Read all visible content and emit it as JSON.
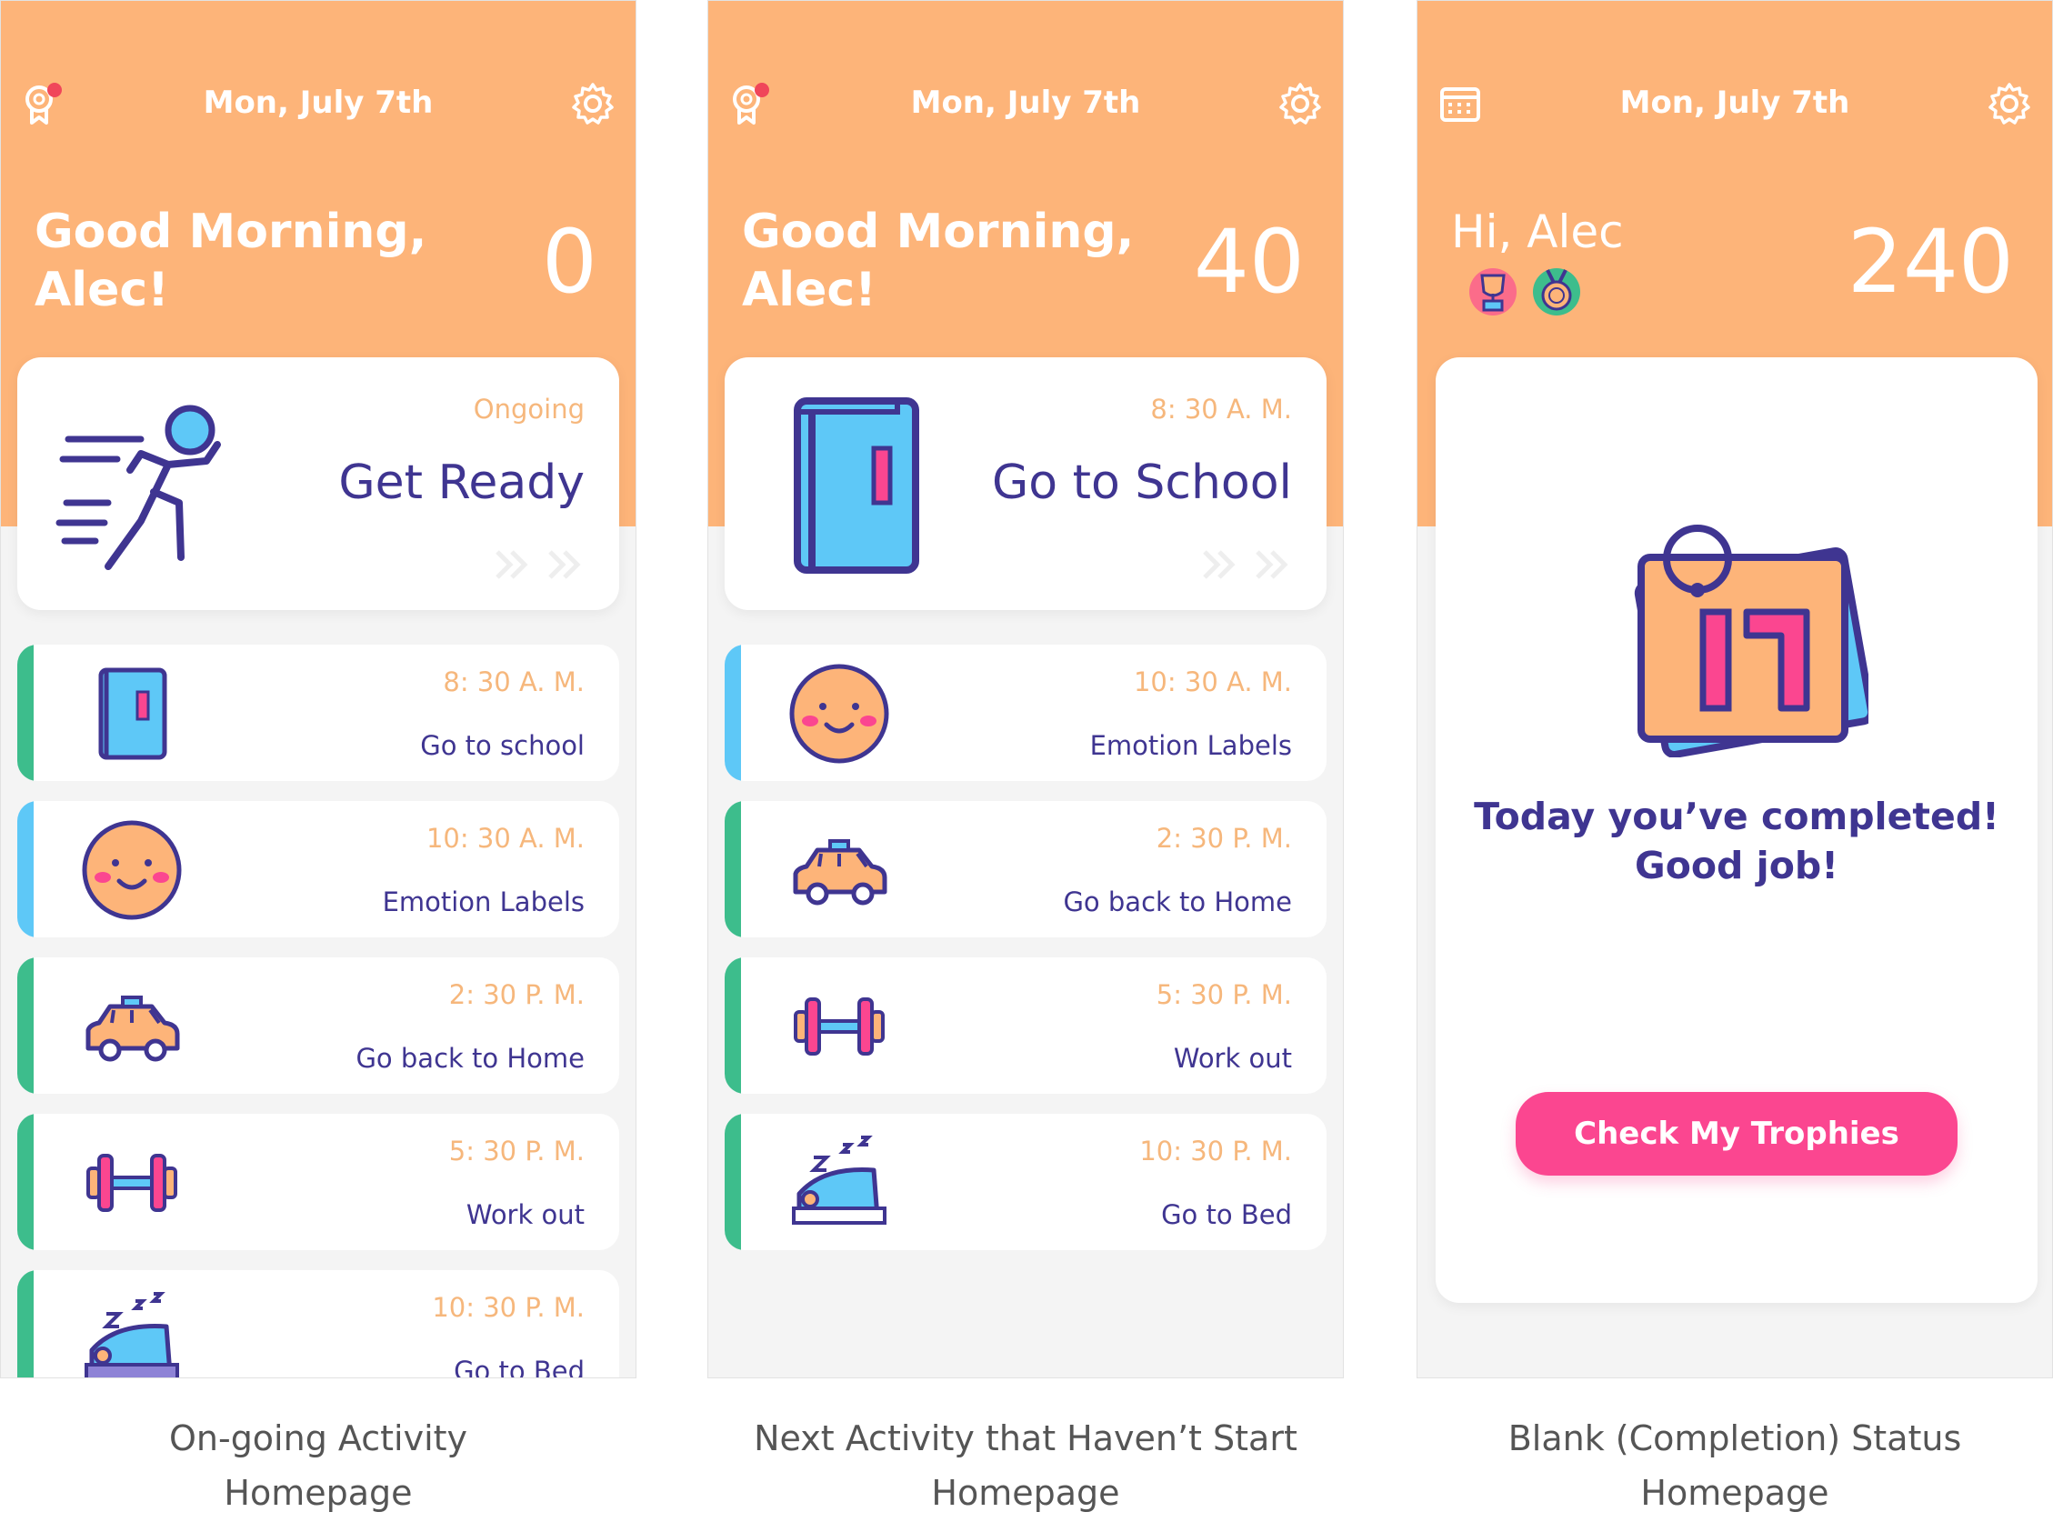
{
  "colors": {
    "header": "#fdb479",
    "accent_pink": "#fb4690",
    "text_purple": "#3f3591",
    "time_orange": "#f6b77c",
    "green_bar": "#3dbd8c",
    "blue_bar": "#5ec8f7"
  },
  "screens": [
    {
      "date": "Mon, July 7th",
      "greeting": "Good Morning,\nAlec!",
      "score": "0",
      "left_icon": "trophy-notification-icon",
      "right_icon": "gear-icon",
      "hero": {
        "time": "Ongoing",
        "name": "Get Ready",
        "icon": "running-person-icon"
      },
      "activities": [
        {
          "time": "8: 30 A. M.",
          "name": "Go to school",
          "icon": "book-icon"
        },
        {
          "time": "10: 30 A. M.",
          "name": "Emotion Labels",
          "icon": "smiley-face-icon"
        },
        {
          "time": "2: 30 P. M.",
          "name": "Go back to Home",
          "icon": "car-icon"
        },
        {
          "time": "5: 30 P. M.",
          "name": "Work out",
          "icon": "dumbbell-icon"
        },
        {
          "time": "10: 30 P. M.",
          "name": "Go to Bed",
          "icon": "bed-icon"
        }
      ],
      "caption": "On-going Activity\nHomepage"
    },
    {
      "date": "Mon, July 7th",
      "greeting": "Good Morning,\nAlec!",
      "score": "40",
      "left_icon": "trophy-notification-icon",
      "right_icon": "gear-icon",
      "hero": {
        "time": "8: 30 A. M.",
        "name": "Go to School",
        "icon": "book-icon"
      },
      "activities": [
        {
          "time": "10: 30 A. M.",
          "name": "Emotion Labels",
          "icon": "smiley-face-icon"
        },
        {
          "time": "2: 30 P. M.",
          "name": "Go back to Home",
          "icon": "car-icon"
        },
        {
          "time": "5: 30 P. M.",
          "name": "Work out",
          "icon": "dumbbell-icon"
        },
        {
          "time": "10: 30 P. M.",
          "name": "Go to Bed",
          "icon": "bed-icon"
        }
      ],
      "caption": "Next Activity that Haven’t Start\nHomepage"
    },
    {
      "date": "Mon, July 7th",
      "greeting": "Hi, Alec",
      "score": "240",
      "left_icon": "calendar-icon",
      "right_icon": "gear-icon",
      "badges": [
        "trophy-badge-icon",
        "medal-badge-icon"
      ],
      "completion": {
        "icon": "calendar-day-17-icon",
        "message": "Today you’ve completed!\nGood job!",
        "button": "Check My Trophies"
      },
      "caption": "Blank (Completion) Status\nHomepage"
    }
  ]
}
